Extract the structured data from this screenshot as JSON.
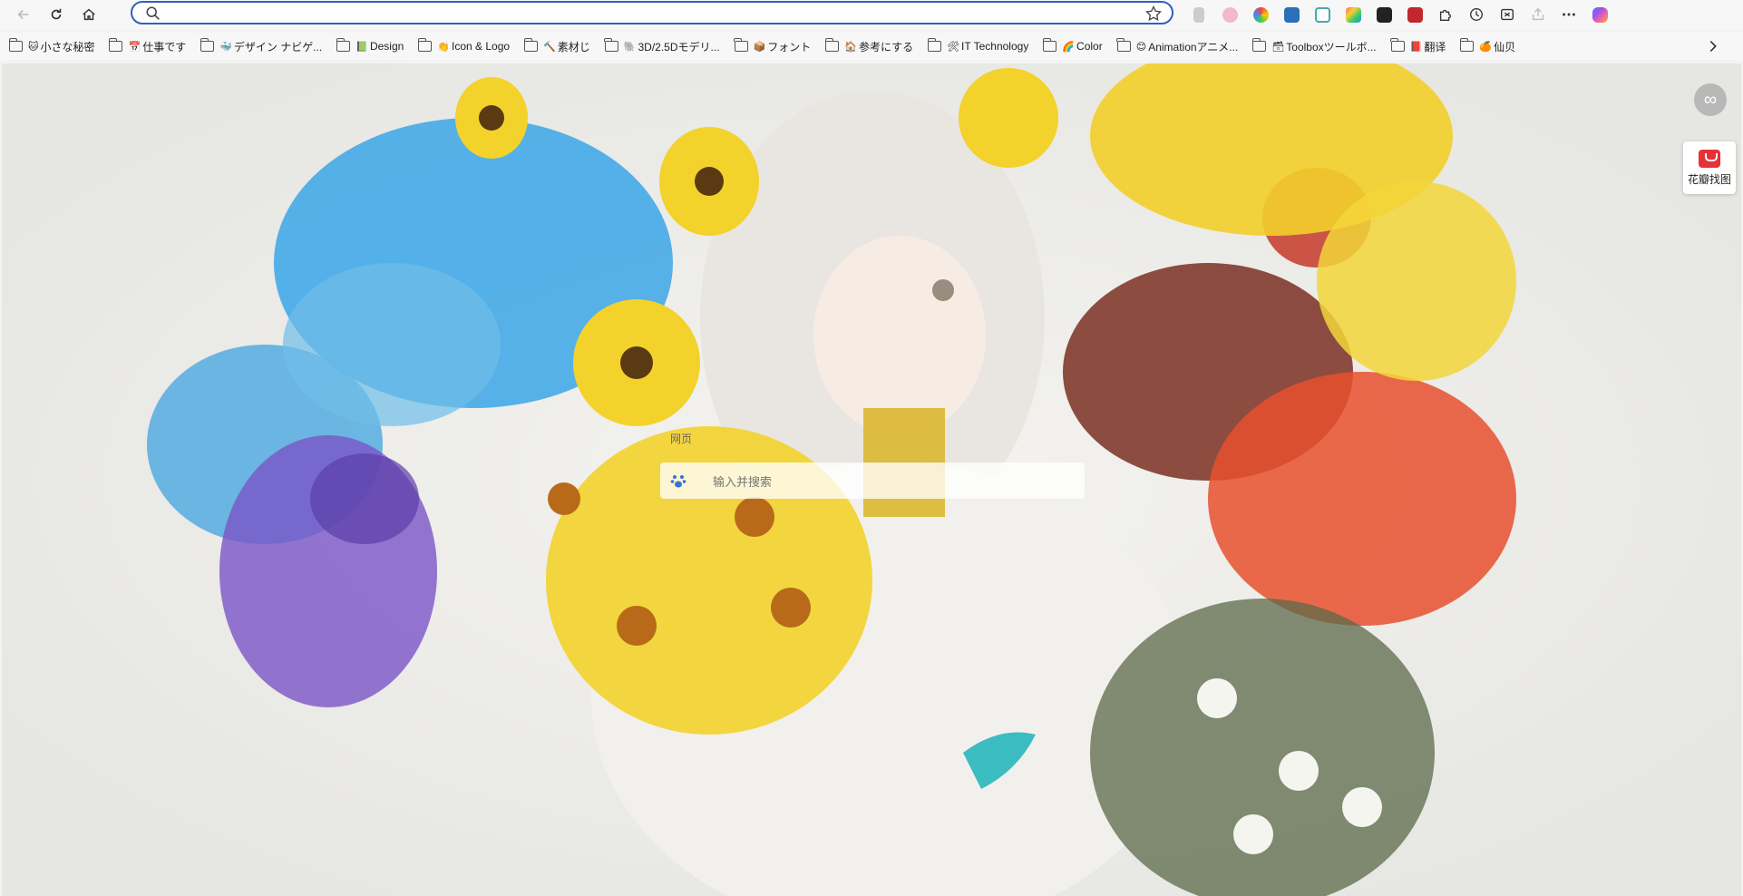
{
  "browser": {
    "address_placeholder": "",
    "address_value": "",
    "extensions": [
      "clipboard-ext-icon",
      "cat-ext-icon",
      "circle-ext-icon",
      "download-ext-icon",
      "tabs-ext-icon",
      "grid-ext-icon",
      "photo-ext-icon",
      "red-doc-ext-icon",
      "puzzle-icon",
      "history-icon",
      "screenshot-icon",
      "share-icon",
      "more-icon",
      "copilot-icon"
    ]
  },
  "bookmarks": [
    {
      "emoji": "🐱",
      "label": "小さな秘密"
    },
    {
      "emoji": "📅",
      "label": "仕事です"
    },
    {
      "emoji": "🐳",
      "label": "デザイン ナビゲ..."
    },
    {
      "emoji": "📗",
      "label": "Design"
    },
    {
      "emoji": "👏",
      "label": "Icon & Logo"
    },
    {
      "emoji": "🔨",
      "label": "素材じ"
    },
    {
      "emoji": "🐘",
      "label": "3D/2.5Dモデリ..."
    },
    {
      "emoji": "📦",
      "label": "フォント"
    },
    {
      "emoji": "🏠",
      "label": "参考にする"
    },
    {
      "emoji": "🛠",
      "label": "IT Technology"
    },
    {
      "emoji": "🌈",
      "label": "Color"
    },
    {
      "emoji": "😊",
      "label": "Animationアニメ..."
    },
    {
      "emoji": "🗃",
      "label": "Toolboxツールボ..."
    },
    {
      "emoji": "📕",
      "label": "翻译"
    },
    {
      "emoji": "🍊",
      "label": "仙贝"
    }
  ],
  "newtab": {
    "search_tab_label": "网页",
    "search_placeholder": "输入并搜索",
    "side_tool_label": "花瓣找图",
    "infinity_label": "∞"
  },
  "colors": {
    "address_border": "#2f5fc4",
    "side_tool_red": "#e53238"
  }
}
